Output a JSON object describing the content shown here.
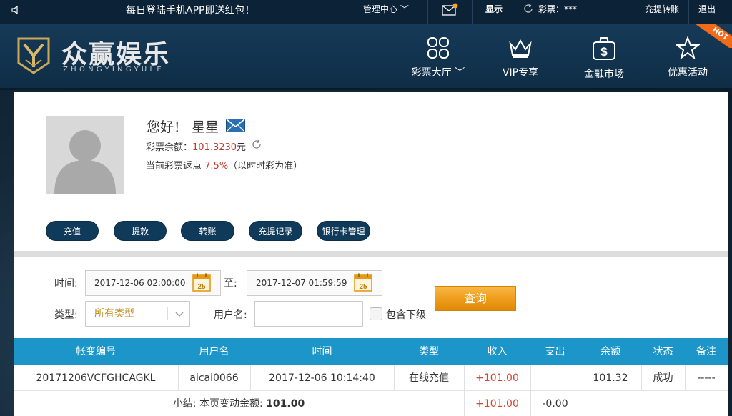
{
  "topbar": {
    "notice": "每日登陆手机APP即送红包！",
    "manage": "管理中心 ﹀",
    "show": "显示",
    "lottery": "彩票：***",
    "deposit_history": "充提转账",
    "logout": "退出"
  },
  "brand": {
    "name": "众赢娱乐",
    "sub": "ZHONGYINGYULE"
  },
  "nav": [
    {
      "label": "彩票大厅 ﹀"
    },
    {
      "label": "VIP专享"
    },
    {
      "label": "金融市场"
    },
    {
      "label": "优惠活动"
    }
  ],
  "hot_badge": "HOT",
  "profile": {
    "greeting": "您好！ 星星",
    "balance_label": "彩票余额：",
    "balance_value": "101.3230",
    "balance_unit": "元",
    "rebate_label": "当前彩票返点 ",
    "rebate_value": "7.5%",
    "rebate_note": "（以时时彩为准）"
  },
  "actions": [
    "充值",
    "提款",
    "转账",
    "充提记录",
    "银行卡管理"
  ],
  "filter": {
    "time_label": "时间:",
    "start": "2017-12-06 02:00:00",
    "to_label": "至:",
    "end": "2017-12-07 01:59:59",
    "cal_day": "25",
    "type_label": "类型:",
    "type_value": "所有类型",
    "username_label": "用户名:",
    "include_sub": "包含下级",
    "query": "查询"
  },
  "table": {
    "headers": [
      "帐变编号",
      "用户名",
      "时间",
      "类型",
      "收入",
      "支出",
      "余额",
      "状态",
      "备注"
    ],
    "row": [
      "20171206VCFGHCAGKL",
      "aicai0066",
      "2017-12-06 10:14:40",
      "在线充值",
      "+101.00",
      "",
      "101.32",
      "成功",
      "-----"
    ],
    "subtotal_label": "小结: 本页变动金额: ",
    "subtotal_value": "101.00",
    "subtotal_income": "+101.00",
    "subtotal_expense": "-0.00"
  }
}
